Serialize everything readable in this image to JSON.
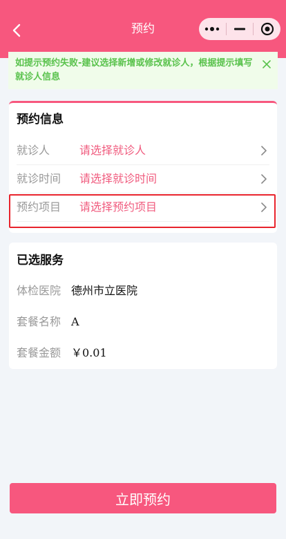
{
  "navbar": {
    "title": "预约",
    "back_icon": "chevron-left-icon",
    "menu_icons": [
      "more-dots-icon",
      "minimize-icon",
      "close-target-icon"
    ]
  },
  "tip": {
    "text": "如提示预约失败-建议选择新增或修改就诊人，根据提示填写就诊人信息",
    "close_icon": "close-icon"
  },
  "appointment": {
    "title": "预约信息",
    "rows": [
      {
        "label": "就诊人",
        "value": "请选择就诊人"
      },
      {
        "label": "就诊时间",
        "value": "请选择就诊时间"
      },
      {
        "label": "预约项目",
        "value": "请选择预约项目"
      }
    ]
  },
  "service": {
    "title": "已选服务",
    "rows": [
      {
        "label": "体检医院",
        "value": "德州市立医院"
      },
      {
        "label": "套餐名称",
        "value": "A"
      },
      {
        "label": "套餐金额",
        "value": "￥0.01"
      }
    ]
  },
  "submit": {
    "label": "立即预约"
  },
  "colors": {
    "primary": "#f7577e",
    "placeholder_value": "#f05b7e",
    "tip_text": "#59c24c",
    "tip_bg": "#f0fcea",
    "highlight_border": "#e8232c",
    "page_bg": "#f2f5f9"
  }
}
